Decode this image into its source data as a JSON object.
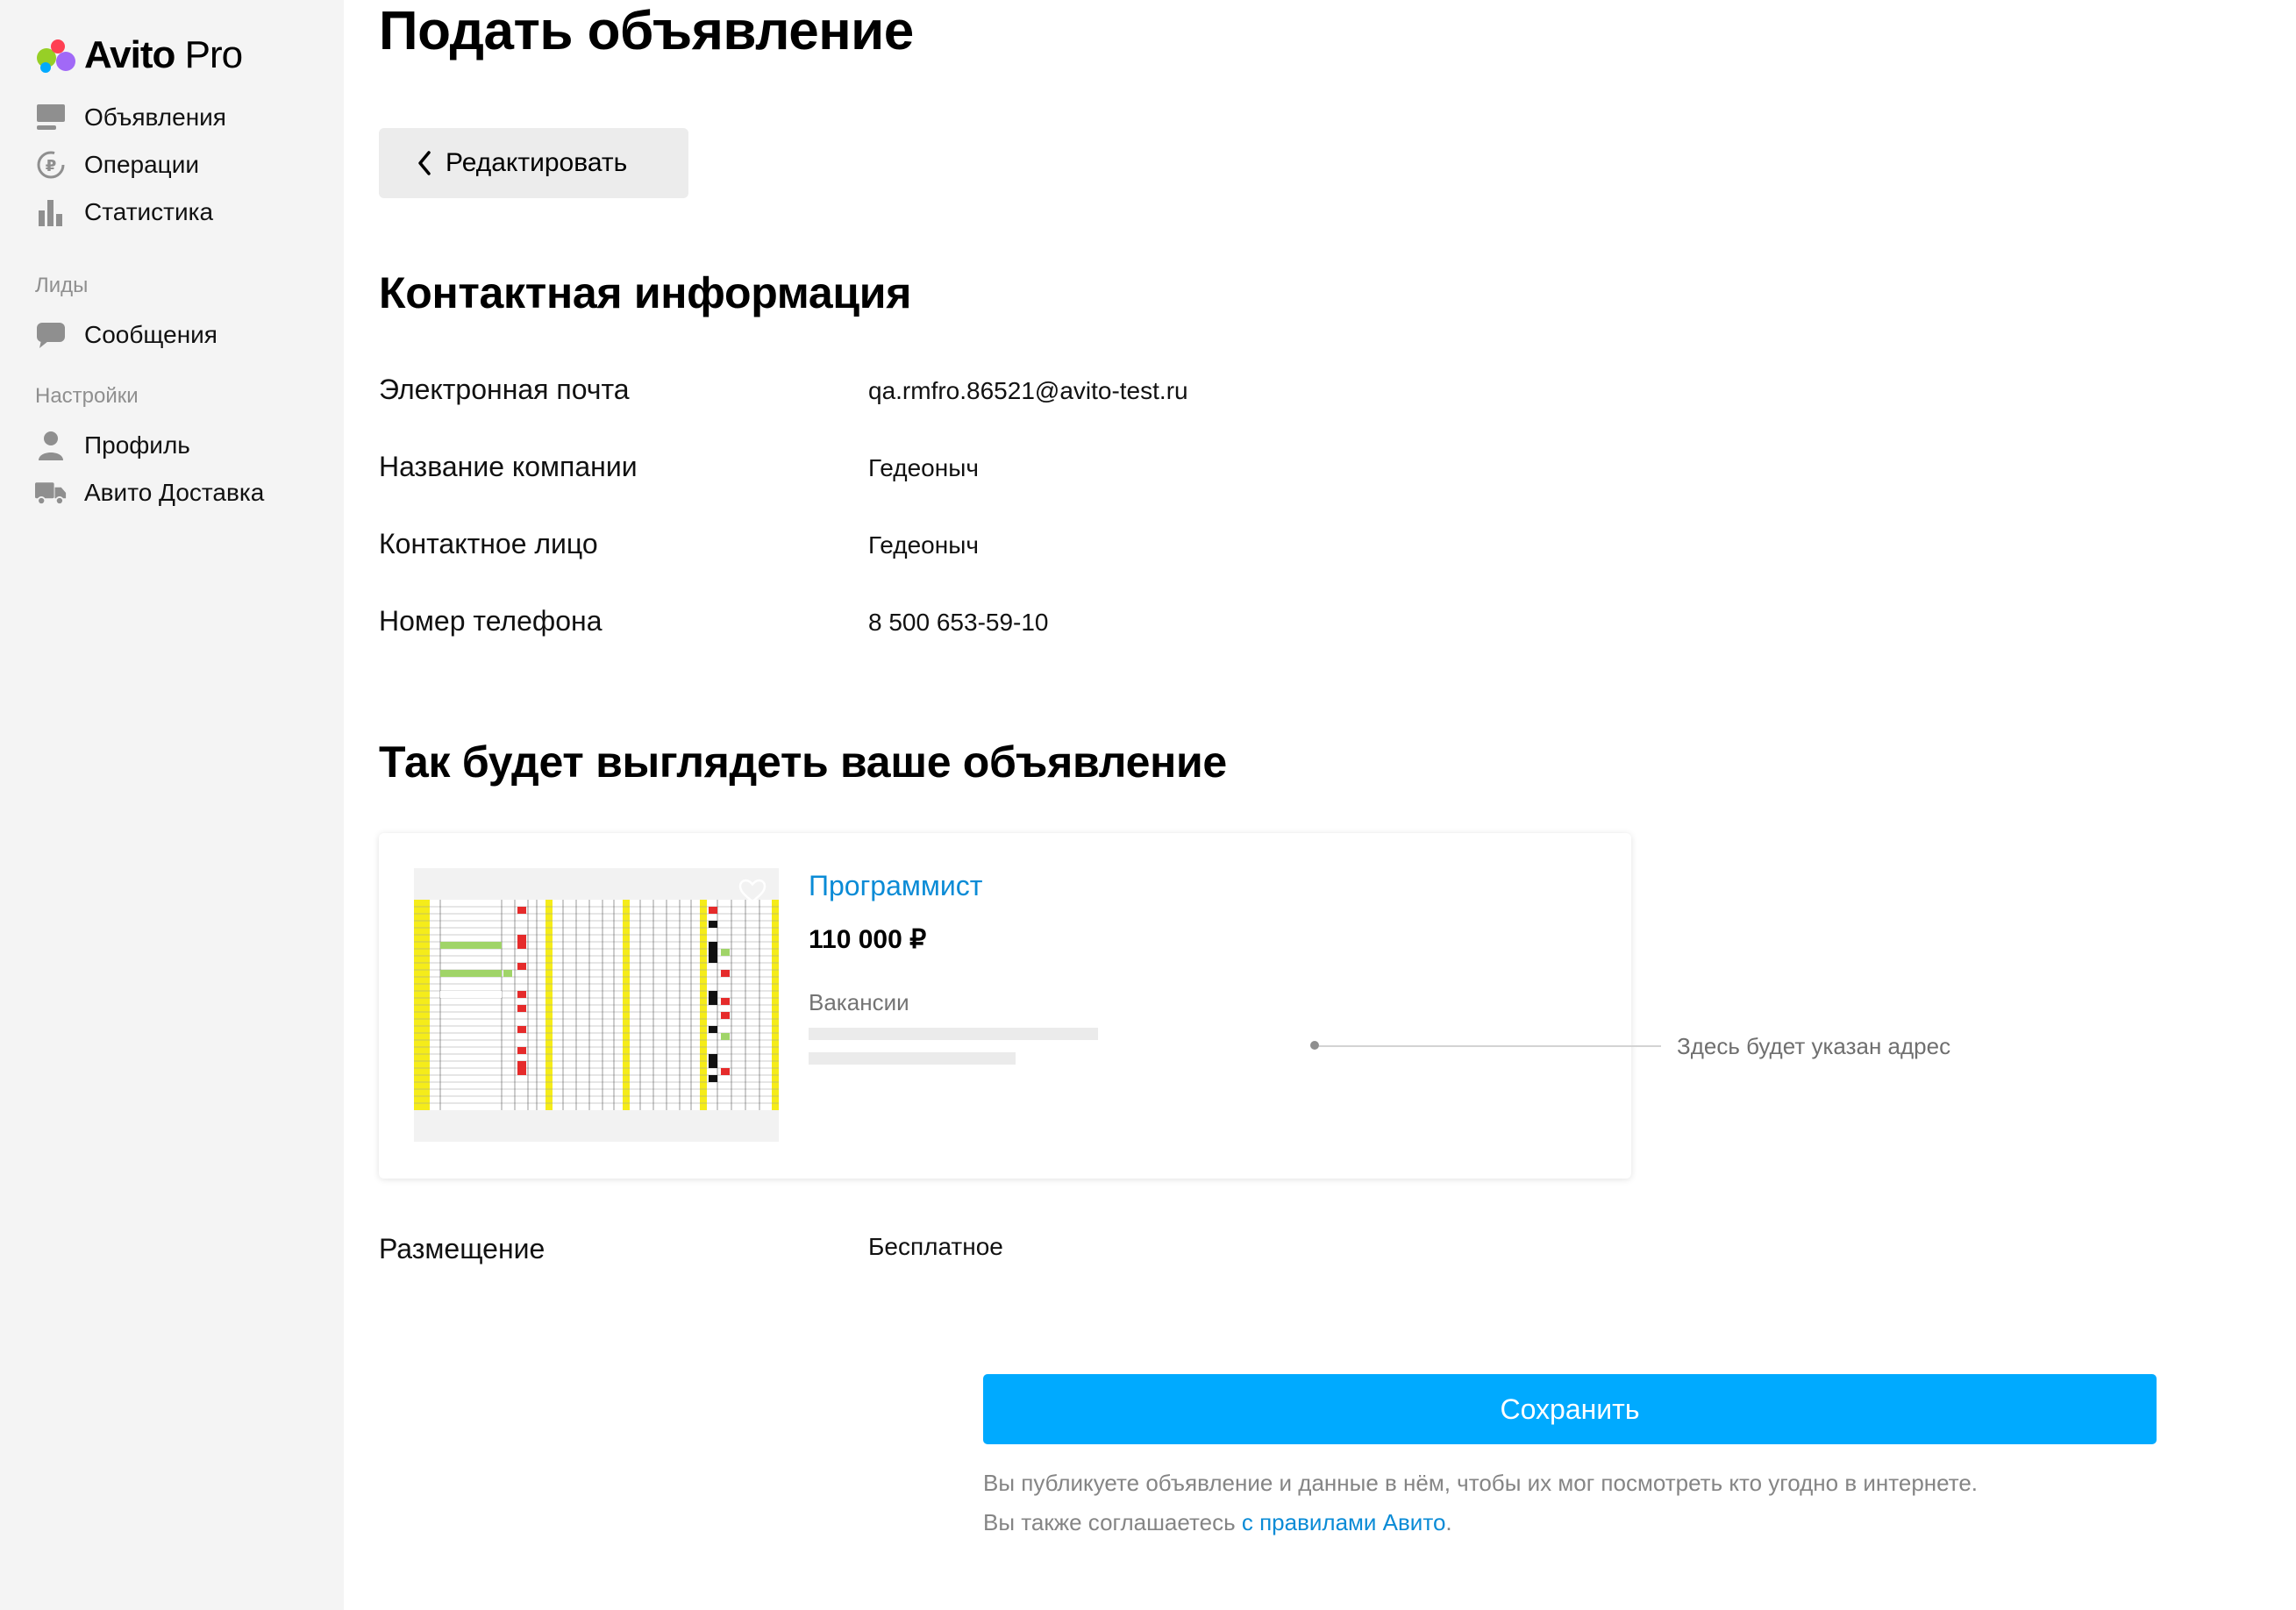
{
  "brand": {
    "name": "Avito",
    "suffix": "Pro",
    "dot_colors": [
      "#00aaff",
      "#97cf26",
      "#a169f7",
      "#ff4053"
    ]
  },
  "sidebar": {
    "items_main": [
      {
        "label": "Объявления",
        "icon": "listing-icon"
      },
      {
        "label": "Операции",
        "icon": "ruble-cycle-icon"
      },
      {
        "label": "Статистика",
        "icon": "bar-chart-icon"
      }
    ],
    "section_leads": "Лиды",
    "items_leads": [
      {
        "label": "Сообщения",
        "icon": "chat-bubble-icon"
      }
    ],
    "section_settings": "Настройки",
    "items_settings": [
      {
        "label": "Профиль",
        "icon": "person-icon"
      },
      {
        "label": "Авито Доставка",
        "icon": "truck-icon"
      }
    ]
  },
  "page": {
    "title": "Подать объявление",
    "edit_button": "Редактировать",
    "contact_heading": "Контактная информация",
    "contacts": [
      {
        "label": "Электронная почта",
        "value": "qa.rmfro.86521@avito-test.ru"
      },
      {
        "label": "Название компании",
        "value": "Гедеоныч"
      },
      {
        "label": "Контактное лицо",
        "value": "Гедеоныч"
      },
      {
        "label": "Номер телефона",
        "value": "8 500 653-59-10"
      }
    ],
    "preview_heading": "Так будет выглядеть ваше объявление",
    "preview": {
      "title": "Программист",
      "price": "110 000 ₽",
      "category": "Вакансии",
      "address_hint": "Здесь будет указан адрес"
    },
    "placement_label": "Размещение",
    "placement_value": "Бесплатное",
    "save_button": "Сохранить",
    "notice_line1": "Вы публикуете объявление и данные в нём, чтобы их мог посмотреть кто угодно в интернете.",
    "notice_line2_prefix": "Вы также соглашаетесь ",
    "notice_link": "с правилами Авито",
    "notice_line2_suffix": "."
  },
  "colors": {
    "accent": "#00aaff",
    "link": "#0a8bd6",
    "sidebar_bg": "#f4f4f4"
  }
}
